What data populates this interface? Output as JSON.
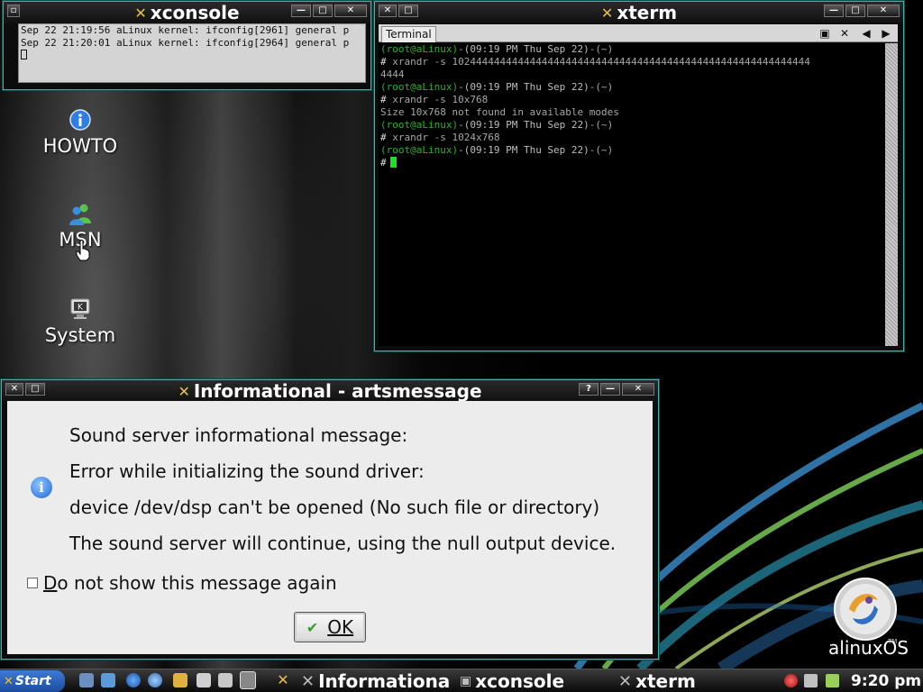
{
  "colors": {
    "accent_border": "#3fb3a8",
    "prompt_user": "#2bb22b",
    "cursor": "#1ee01e",
    "start_button": "#2d66c4"
  },
  "xconsole": {
    "title": "xconsole",
    "lines": [
      "Sep 22 21:19:56 aLinux kernel: ifconfig[2961] general p",
      "Sep 22 21:20:01 aLinux kernel: ifconfig[2964] general p"
    ]
  },
  "xterm": {
    "title": "xterm",
    "tab_label": "Terminal",
    "prompt_user": "(root@aLinux)",
    "prompt_sep": "-",
    "prompt_date": "(09:19 PM Thu Sep 22)",
    "prompt_dir": "-(~)",
    "hash": "#",
    "cmd1": " xrandr -s 102444444444444444444444444444444444444444444444444444444444",
    "cmd1_wrap": "4444",
    "cmd2": " xrandr -s 10x768",
    "output2": "Size 10x768 not found in available modes",
    "cmd3": " xrandr -s 1024x768"
  },
  "desktop": {
    "icons": [
      {
        "label": "HOWTO",
        "icon": "info-icon"
      },
      {
        "label": "MSN",
        "icon": "users-icon"
      },
      {
        "label": "System",
        "icon": "monitor-icon"
      }
    ]
  },
  "dialog": {
    "title": "Informational - artsmessage",
    "line1": "Sound server informational message:",
    "line2": "Error while initializing the sound driver:",
    "line3": "device /dev/dsp can't be opened (No such file or directory)",
    "line4": "The sound server will continue, using the null output device.",
    "checkbox_mnemonic": "D",
    "checkbox_rest": "o not show this message again",
    "checkbox_checked": false,
    "ok_label": "OK",
    "help_glyph": "?"
  },
  "branding": {
    "logo_text": "alinuxOS",
    "tm": "TM"
  },
  "taskbar": {
    "start_label": "Start",
    "tasks": [
      {
        "label": "Informational",
        "icon": "x-icon"
      },
      {
        "label": "xconsole",
        "icon": "console-icon"
      },
      {
        "label": "xterm",
        "icon": "x-icon"
      }
    ],
    "clock": "9:20 pm"
  }
}
